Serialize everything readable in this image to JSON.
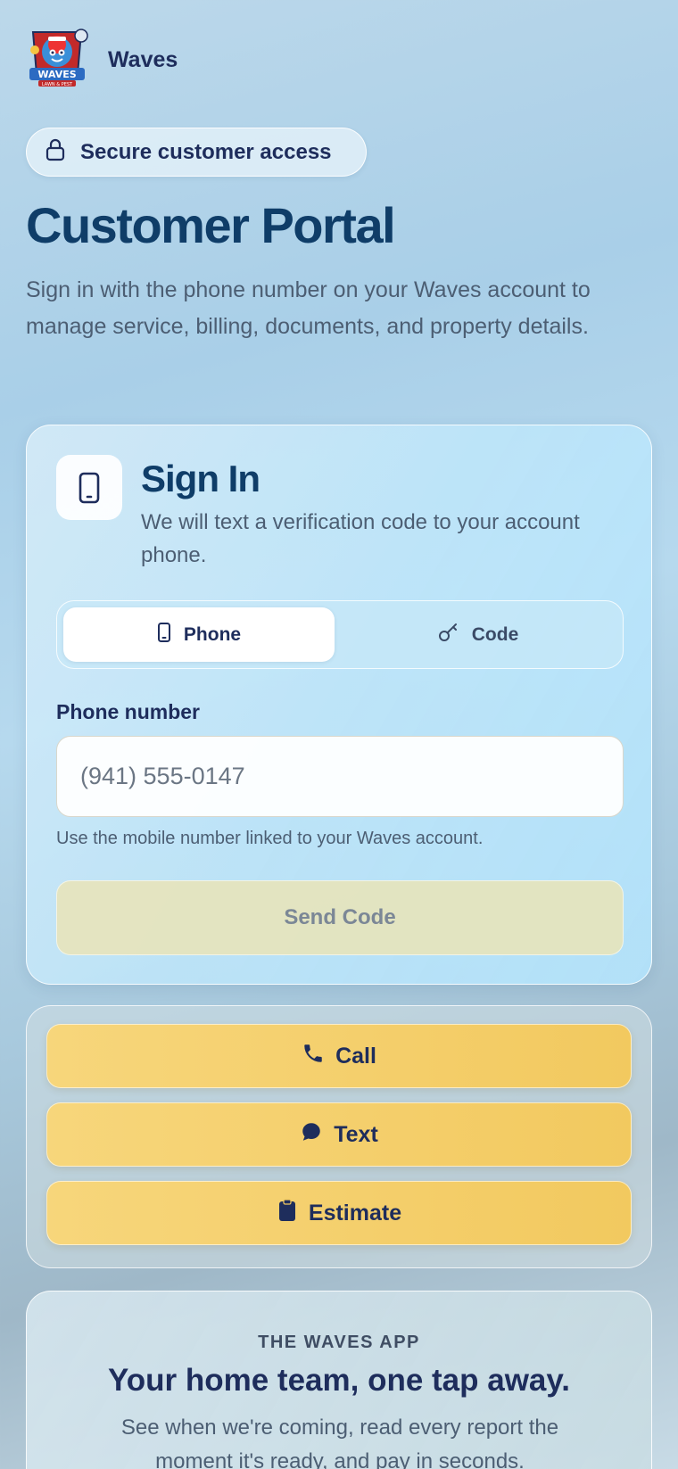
{
  "header": {
    "brand_name": "Waves",
    "logo_text": "WAVES",
    "logo_subtext": "LAWN & PEST"
  },
  "badge": {
    "icon": "lock-icon",
    "label": "Secure customer access"
  },
  "hero": {
    "title": "Customer Portal",
    "subtitle": "Sign in with the phone number on your Waves account to manage service, billing, documents, and property details."
  },
  "signin": {
    "icon": "phone-device-icon",
    "title": "Sign In",
    "description": "We will text a verification code to your account phone.",
    "tabs": [
      {
        "label": "Phone",
        "icon": "phone-device-icon",
        "active": true
      },
      {
        "label": "Code",
        "icon": "key-icon",
        "active": false
      }
    ],
    "field_label": "Phone number",
    "field_placeholder": "(941) 555-0147",
    "field_value": "",
    "helper": "Use the mobile number linked to your Waves account.",
    "submit_label": "Send Code"
  },
  "actions": [
    {
      "label": "Call",
      "icon": "phone-icon"
    },
    {
      "label": "Text",
      "icon": "chat-bubble-icon"
    },
    {
      "label": "Estimate",
      "icon": "clipboard-icon"
    }
  ],
  "promo": {
    "eyebrow": "THE WAVES APP",
    "title": "Your home team, one tap away.",
    "description": "See when we're coming, read every report the moment it's ready, and pay in seconds."
  },
  "colors": {
    "title": "#0f3d68",
    "text": "#1e2d5c",
    "accent_yellow": "#f2c95f",
    "muted": "#4c5e73"
  }
}
